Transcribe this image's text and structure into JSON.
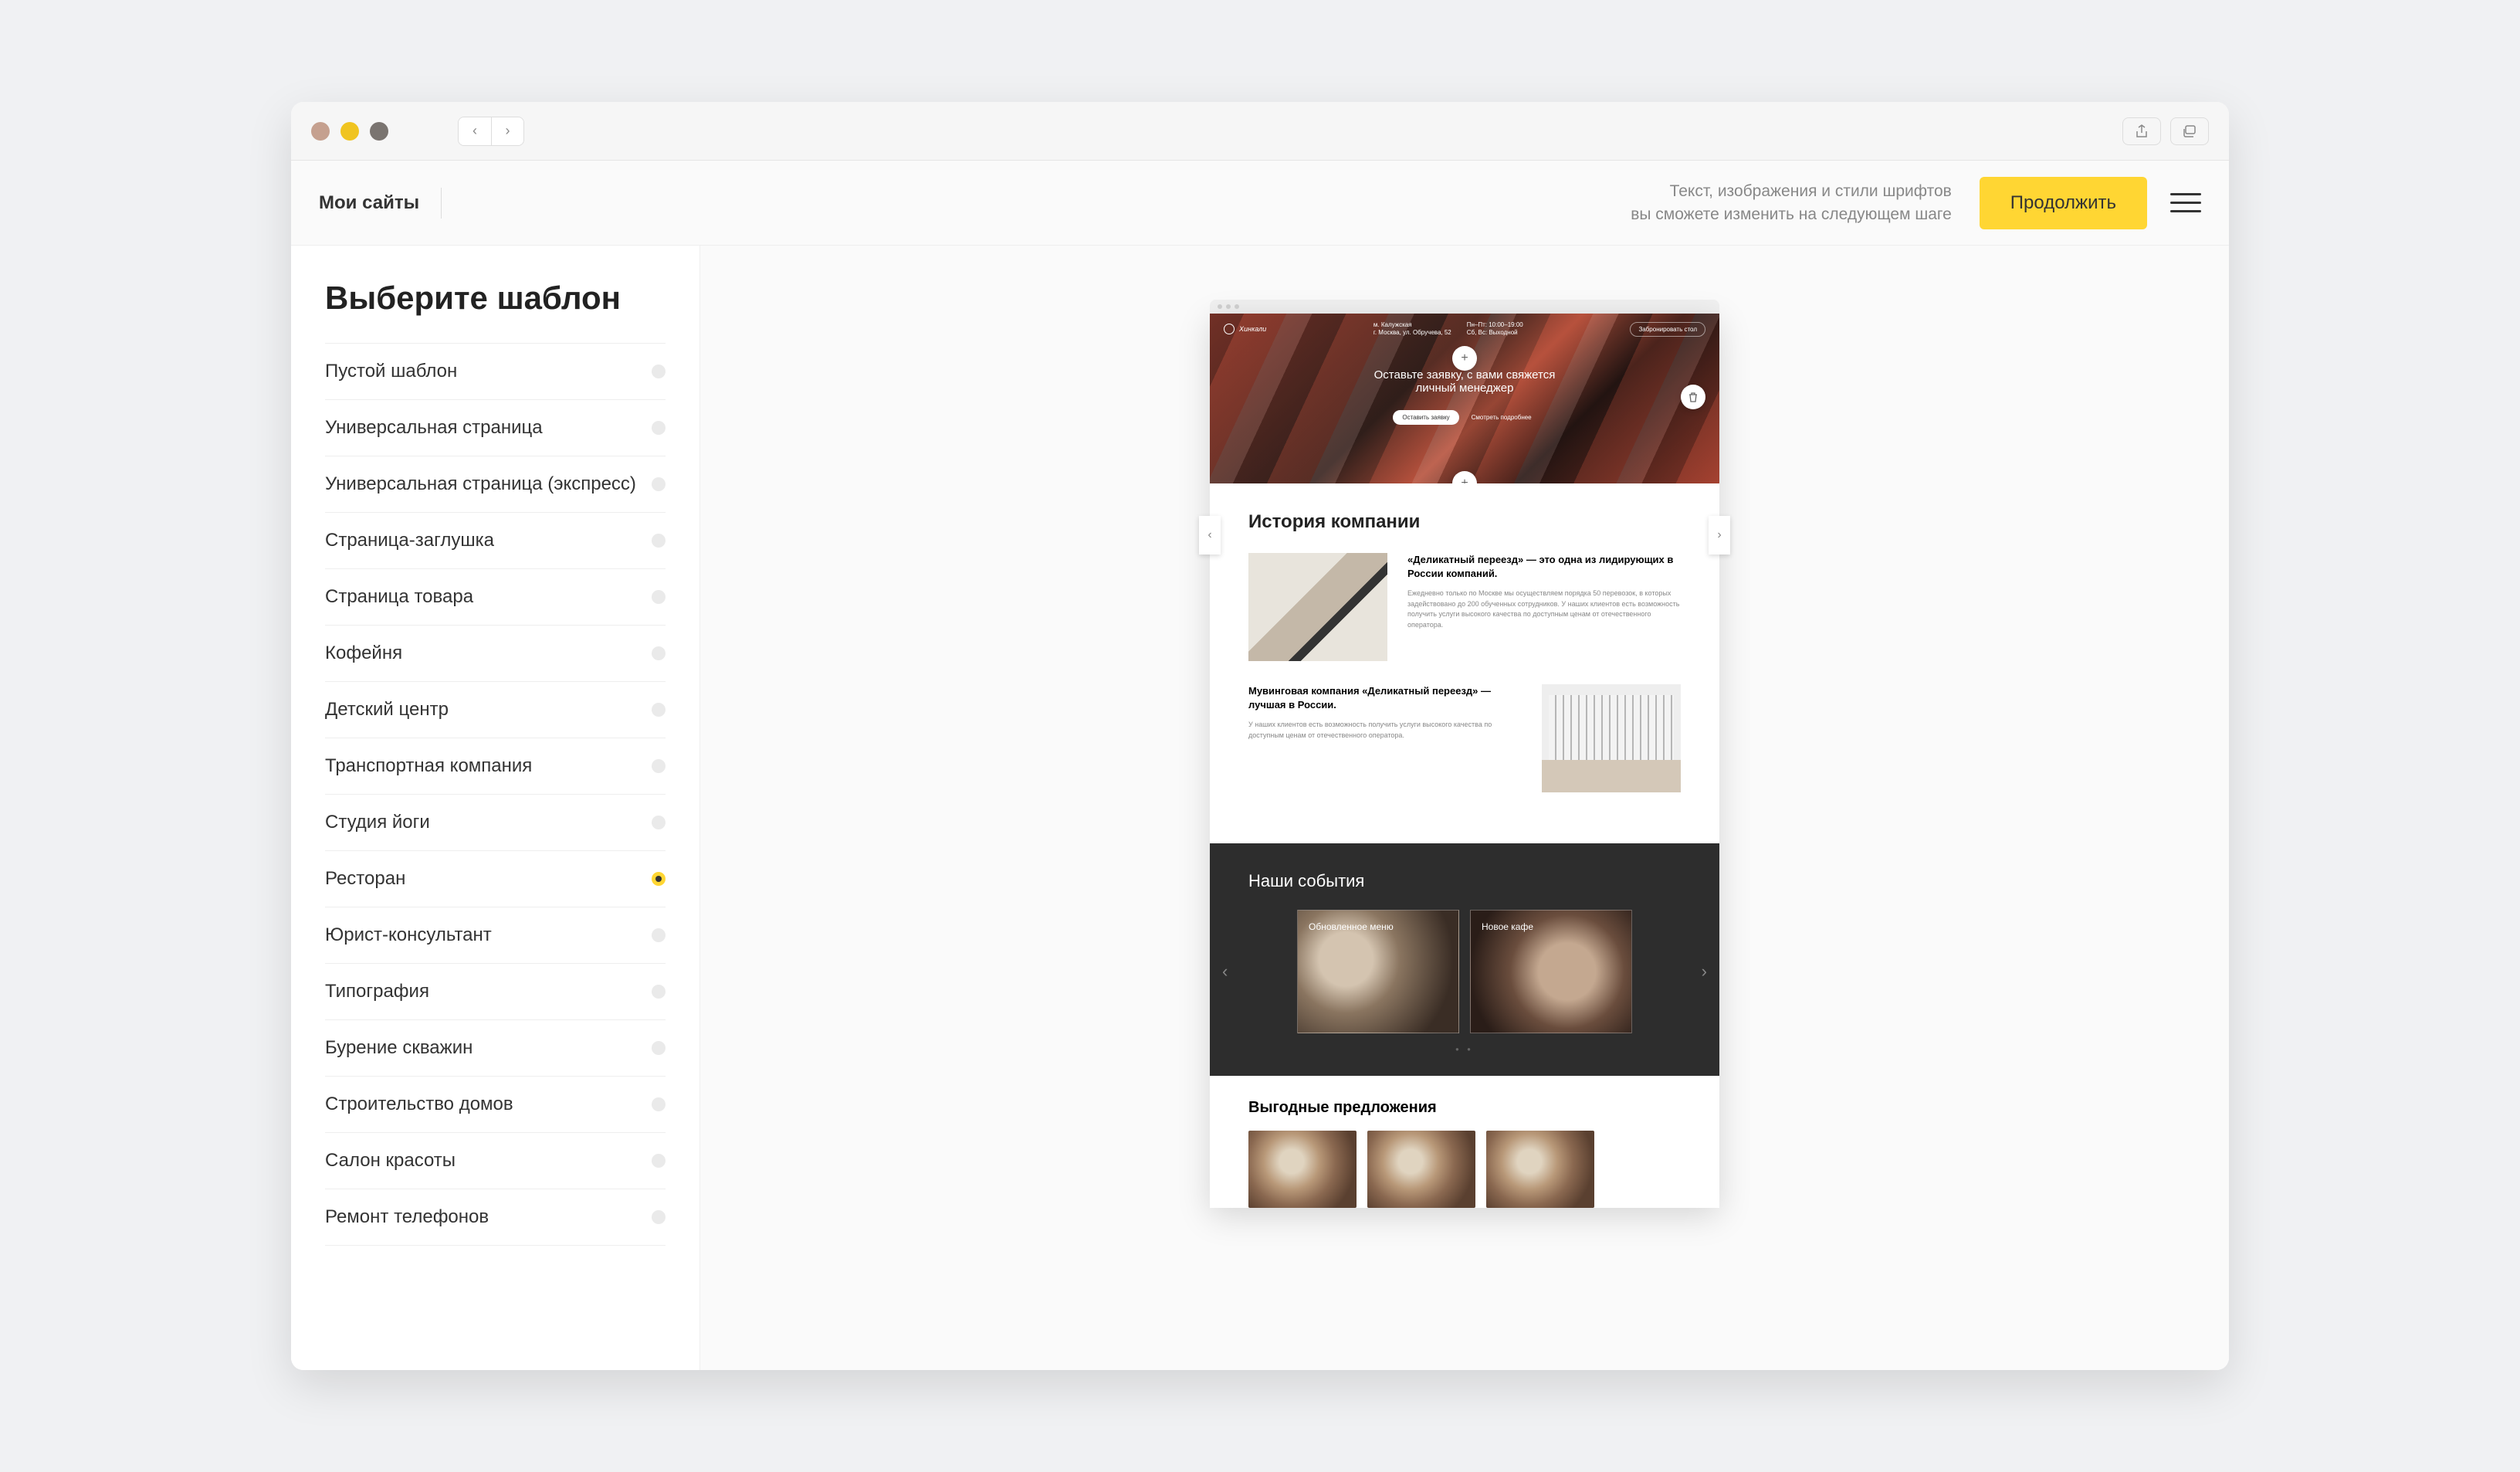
{
  "header": {
    "my_sites": "Мои сайты",
    "hint_line1": "Текст, изображения и стили шрифтов",
    "hint_line2": "вы сможете изменить на следующем шаге",
    "continue": "Продолжить"
  },
  "sidebar": {
    "title": "Выберите шаблон",
    "items": [
      {
        "label": "Пустой шаблон",
        "selected": false
      },
      {
        "label": "Универсальная страница",
        "selected": false
      },
      {
        "label": "Универсальная страница (экспресс)",
        "selected": false
      },
      {
        "label": "Страница-заглушка",
        "selected": false
      },
      {
        "label": "Страница товара",
        "selected": false
      },
      {
        "label": "Кофейня",
        "selected": false
      },
      {
        "label": "Детский центр",
        "selected": false
      },
      {
        "label": "Транспортная компания",
        "selected": false
      },
      {
        "label": "Студия йоги",
        "selected": false
      },
      {
        "label": "Ресторан",
        "selected": true
      },
      {
        "label": "Юрист-консультант",
        "selected": false
      },
      {
        "label": "Типография",
        "selected": false
      },
      {
        "label": "Бурение скважин",
        "selected": false
      },
      {
        "label": "Строительство домов",
        "selected": false
      },
      {
        "label": "Салон красоты",
        "selected": false
      },
      {
        "label": "Ремонт телефонов",
        "selected": false
      }
    ]
  },
  "preview": {
    "hero": {
      "logo_text": "Хинкали",
      "address1": "м. Калужская",
      "address2": "г. Москва, ул. Обручева, 52",
      "hours1": "Пн–Пт: 10:00–19:00",
      "hours2": "Сб, Вс: Выходной",
      "reserve": "Забронировать стол",
      "title1": "Оставьте заявку, с вами свяжется",
      "title2": "личный менеджер",
      "btn_primary": "Оставить заявку",
      "btn_secondary": "Смотреть подробнее"
    },
    "story": {
      "title": "История компании",
      "row1_heading": "«Деликатный переезд» — это одна из лидирующих в России компаний.",
      "row1_desc": "Ежедневно только по Москве мы осуществляем порядка 50 перевозок, в которых задействовано до 200 обученных сотрудников. У наших клиентов есть возможность получить услуги высокого качества по доступным ценам от отечественного оператора.",
      "row2_heading": "Мувинговая компания «Деликатный переезд» — лучшая в России.",
      "row2_desc": "У наших клиентов есть возможность получить услуги высокого качества по доступным ценам от отечественного оператора."
    },
    "events": {
      "title": "Наши события",
      "card1": "Обновленное меню",
      "card2": "Новое кафе"
    },
    "offers": {
      "title": "Выгодные предложения"
    }
  }
}
